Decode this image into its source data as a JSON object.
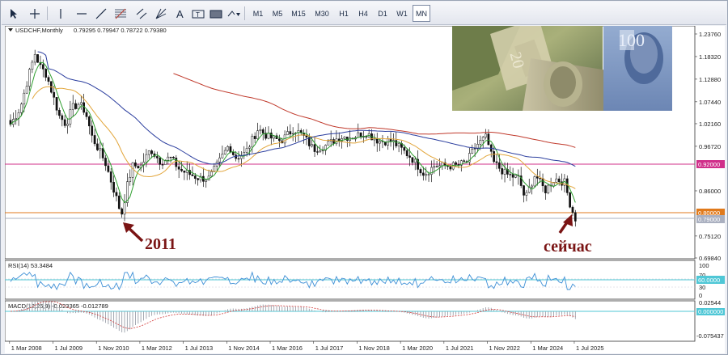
{
  "toolbar": {
    "tools": [
      "cursor-icon",
      "crosshair-icon",
      "vertical-line-icon",
      "horizontal-line-icon",
      "trendline-icon",
      "fibonacci-icon",
      "text-icon",
      "text-label-icon",
      "rectangle-icon",
      "shapes-icon"
    ],
    "timeframes": [
      "M1",
      "M5",
      "M15",
      "M30",
      "H1",
      "H4",
      "D1",
      "W1",
      "MN"
    ],
    "active_timeframe": "MN"
  },
  "chart": {
    "header_symbol": "USDCHF,Monthly",
    "header_values": "0.79295 0.79947 0.78722 0.79380",
    "price_ticks": [
      "1.23760",
      "1.18320",
      "1.12880",
      "1.07440",
      "1.02160",
      "0.96720",
      "0.92000",
      "0.86000",
      "0.80000",
      "0.79000",
      "0.75120",
      "0.69840"
    ],
    "level_labels": {
      "resistance": "0.92000",
      "support": "0.80000",
      "current": "0.79000"
    },
    "x_ticks": [
      "1 Mar 2008",
      "1 Jul 2009",
      "1 Nov 2010",
      "1 Mar 2012",
      "1 Jul 2013",
      "1 Nov 2014",
      "1 Mar 2016",
      "1 Jul 2017",
      "1 Nov 2018",
      "1 Mar 2020",
      "1 Jul 2021",
      "1 Nov 2022",
      "1 Mar 2024",
      "1 Jul 2025"
    ],
    "annotation_2011": "2011",
    "annotation_now": "сейчас",
    "colors": {
      "ma_fast": "#2e9e2e",
      "ma_mid": "#e2a53a",
      "ma_slow": "#2a3d9e",
      "ma_long": "#c0392b",
      "resistance": "#d02f8a",
      "support": "#e07a1c",
      "arrow": "#7a1414"
    }
  },
  "rsi": {
    "header": "RSI(14) 53.3484",
    "ticks": [
      "100",
      "70",
      "30",
      "0"
    ],
    "level_label": "60.0000"
  },
  "macd": {
    "header": "MACD(12,26,9) -0.023365 -0.012789",
    "ticks": [
      "0.02544",
      "-0.075437"
    ],
    "level_label": "0.000000"
  },
  "chart_data": {
    "type": "candlestick",
    "symbol": "USDCHF",
    "timeframe": "Monthly",
    "x_start": "2008-03",
    "x_end": "2025-07",
    "ylim": [
      0.6984,
      1.2376
    ],
    "key_levels": [
      0.92,
      0.8,
      0.79
    ],
    "path_points": [
      [
        2008.2,
        1.02
      ],
      [
        2008.5,
        1.06
      ],
      [
        2008.8,
        1.15
      ],
      [
        2008.95,
        1.19
      ],
      [
        2009.1,
        1.16
      ],
      [
        2009.3,
        1.14
      ],
      [
        2009.5,
        1.09
      ],
      [
        2009.7,
        1.04
      ],
      [
        2009.9,
        1.02
      ],
      [
        2010.1,
        1.06
      ],
      [
        2010.3,
        1.07
      ],
      [
        2010.5,
        1.05
      ],
      [
        2010.7,
        0.99
      ],
      [
        2010.9,
        0.96
      ],
      [
        2011.1,
        0.93
      ],
      [
        2011.3,
        0.88
      ],
      [
        2011.5,
        0.83
      ],
      [
        2011.6,
        0.8
      ],
      [
        2011.8,
        0.88
      ],
      [
        2011.95,
        0.92
      ],
      [
        2012.2,
        0.92
      ],
      [
        2012.5,
        0.96
      ],
      [
        2012.8,
        0.93
      ],
      [
        2013.1,
        0.94
      ],
      [
        2013.4,
        0.91
      ],
      [
        2013.7,
        0.9
      ],
      [
        2014.0,
        0.89
      ],
      [
        2014.3,
        0.89
      ],
      [
        2014.6,
        0.93
      ],
      [
        2014.9,
        0.97
      ],
      [
        2015.1,
        0.94
      ],
      [
        2015.4,
        0.95
      ],
      [
        2015.8,
        1.01
      ],
      [
        2016.1,
        0.99
      ],
      [
        2016.5,
        0.98
      ],
      [
        2016.9,
        1.01
      ],
      [
        2017.2,
        0.99
      ],
      [
        2017.5,
        0.96
      ],
      [
        2017.9,
        0.97
      ],
      [
        2018.3,
        0.99
      ],
      [
        2018.7,
        0.99
      ],
      [
        2019.1,
        1.0
      ],
      [
        2019.5,
        0.98
      ],
      [
        2019.9,
        0.98
      ],
      [
        2020.2,
        0.96
      ],
      [
        2020.5,
        0.94
      ],
      [
        2020.9,
        0.9
      ],
      [
        2021.2,
        0.92
      ],
      [
        2021.6,
        0.92
      ],
      [
        2021.9,
        0.92
      ],
      [
        2022.2,
        0.93
      ],
      [
        2022.5,
        0.97
      ],
      [
        2022.8,
        0.99
      ],
      [
        2023.0,
        0.93
      ],
      [
        2023.4,
        0.9
      ],
      [
        2023.8,
        0.89
      ],
      [
        2023.99,
        0.84
      ],
      [
        2024.3,
        0.9
      ],
      [
        2024.6,
        0.86
      ],
      [
        2024.9,
        0.89
      ],
      [
        2025.2,
        0.88
      ],
      [
        2025.4,
        0.82
      ],
      [
        2025.55,
        0.79
      ]
    ]
  }
}
